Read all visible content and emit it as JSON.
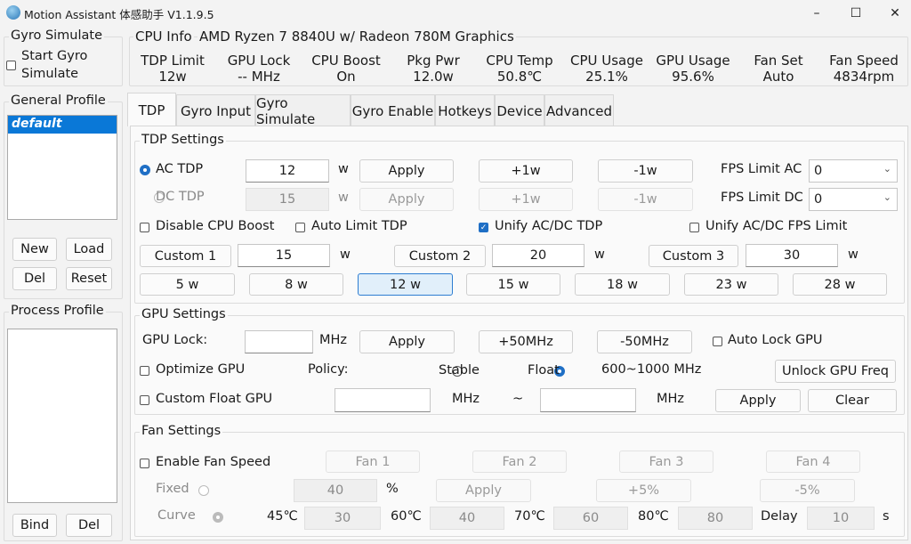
{
  "window": {
    "title": "Motion Assistant 体感助手 V1.1.9.5",
    "minimize": "–",
    "maximize": "☐",
    "close": "✕"
  },
  "gyro_simulate": {
    "title": "Gyro Simulate",
    "checkbox_label_1": "Start Gyro",
    "checkbox_label_2": "Simulate"
  },
  "general_profile": {
    "title": "General Profile",
    "items": [
      "default"
    ],
    "buttons": {
      "new": "New",
      "load": "Load",
      "del": "Del",
      "reset": "Reset"
    }
  },
  "process_profile": {
    "title": "Process Profile",
    "buttons": {
      "bind": "Bind",
      "del": "Del"
    }
  },
  "cpu_info": {
    "title": "CPU Info",
    "cpu_name": "AMD Ryzen 7 8840U w/ Radeon 780M Graphics",
    "metrics": [
      {
        "label": "TDP Limit",
        "value": "12w"
      },
      {
        "label": "GPU Lock",
        "value": "-- MHz"
      },
      {
        "label": "CPU Boost",
        "value": "On"
      },
      {
        "label": "Pkg Pwr",
        "value": "12.0w"
      },
      {
        "label": "CPU Temp",
        "value": "50.8℃"
      },
      {
        "label": "CPU Usage",
        "value": "25.1%"
      },
      {
        "label": "GPU Usage",
        "value": "95.6%"
      },
      {
        "label": "Fan Set",
        "value": "Auto"
      },
      {
        "label": "Fan Speed",
        "value": "4834rpm"
      }
    ]
  },
  "tabs": [
    "TDP",
    "Gyro Input",
    "Gyro Simulate",
    "Gyro Enable",
    "Hotkeys",
    "Device",
    "Advanced"
  ],
  "tdp": {
    "title": "TDP Settings",
    "ac_label": "AC TDP",
    "ac_value": "12",
    "dc_label": "DC TDP",
    "dc_value": "15",
    "unit": "w",
    "apply": "Apply",
    "plus": "+1w",
    "minus": "-1w",
    "fps_ac_label": "FPS Limit AC",
    "fps_ac_value": "0",
    "fps_dc_label": "FPS Limit DC",
    "fps_dc_value": "0",
    "disable_boost": "Disable CPU Boost",
    "auto_limit": "Auto Limit TDP",
    "unify_tdp": "Unify AC/DC TDP",
    "unify_fps": "Unify AC/DC FPS Limit",
    "custom1_label": "Custom 1",
    "custom1_value": "15",
    "custom2_label": "Custom 2",
    "custom2_value": "20",
    "custom3_label": "Custom 3",
    "custom3_value": "30",
    "presets": [
      "5 w",
      "8 w",
      "12 w",
      "15 w",
      "18 w",
      "23 w",
      "28 w"
    ]
  },
  "gpu": {
    "title": "GPU Settings",
    "lock_label": "GPU Lock:",
    "lock_value": "",
    "mhz": "MHz",
    "apply": "Apply",
    "plus": "+50MHz",
    "minus": "-50MHz",
    "auto_lock": "Auto Lock GPU",
    "optimize": "Optimize GPU",
    "policy": "Policy:",
    "stable": "Stable",
    "float": "Float",
    "range": "600~1000 MHz",
    "unlock": "Unlock GPU Freq",
    "custom_float": "Custom Float GPU",
    "tilde": "~",
    "clear": "Clear"
  },
  "fan": {
    "title": "Fan Settings",
    "enable": "Enable Fan Speed",
    "fans": [
      "Fan 1",
      "Fan 2",
      "Fan 3",
      "Fan 4"
    ],
    "fixed": "Fixed",
    "fixed_value": "40",
    "percent": "%",
    "apply": "Apply",
    "plus": "+5%",
    "minus": "-5%",
    "curve": "Curve",
    "curve_points": [
      {
        "temp": "45℃",
        "value": "30"
      },
      {
        "temp": "60℃",
        "value": "40"
      },
      {
        "temp": "70℃",
        "value": "60"
      },
      {
        "temp": "80℃",
        "value": "80"
      }
    ],
    "delay_label": "Delay",
    "delay_value": "10",
    "delay_unit": "s"
  }
}
